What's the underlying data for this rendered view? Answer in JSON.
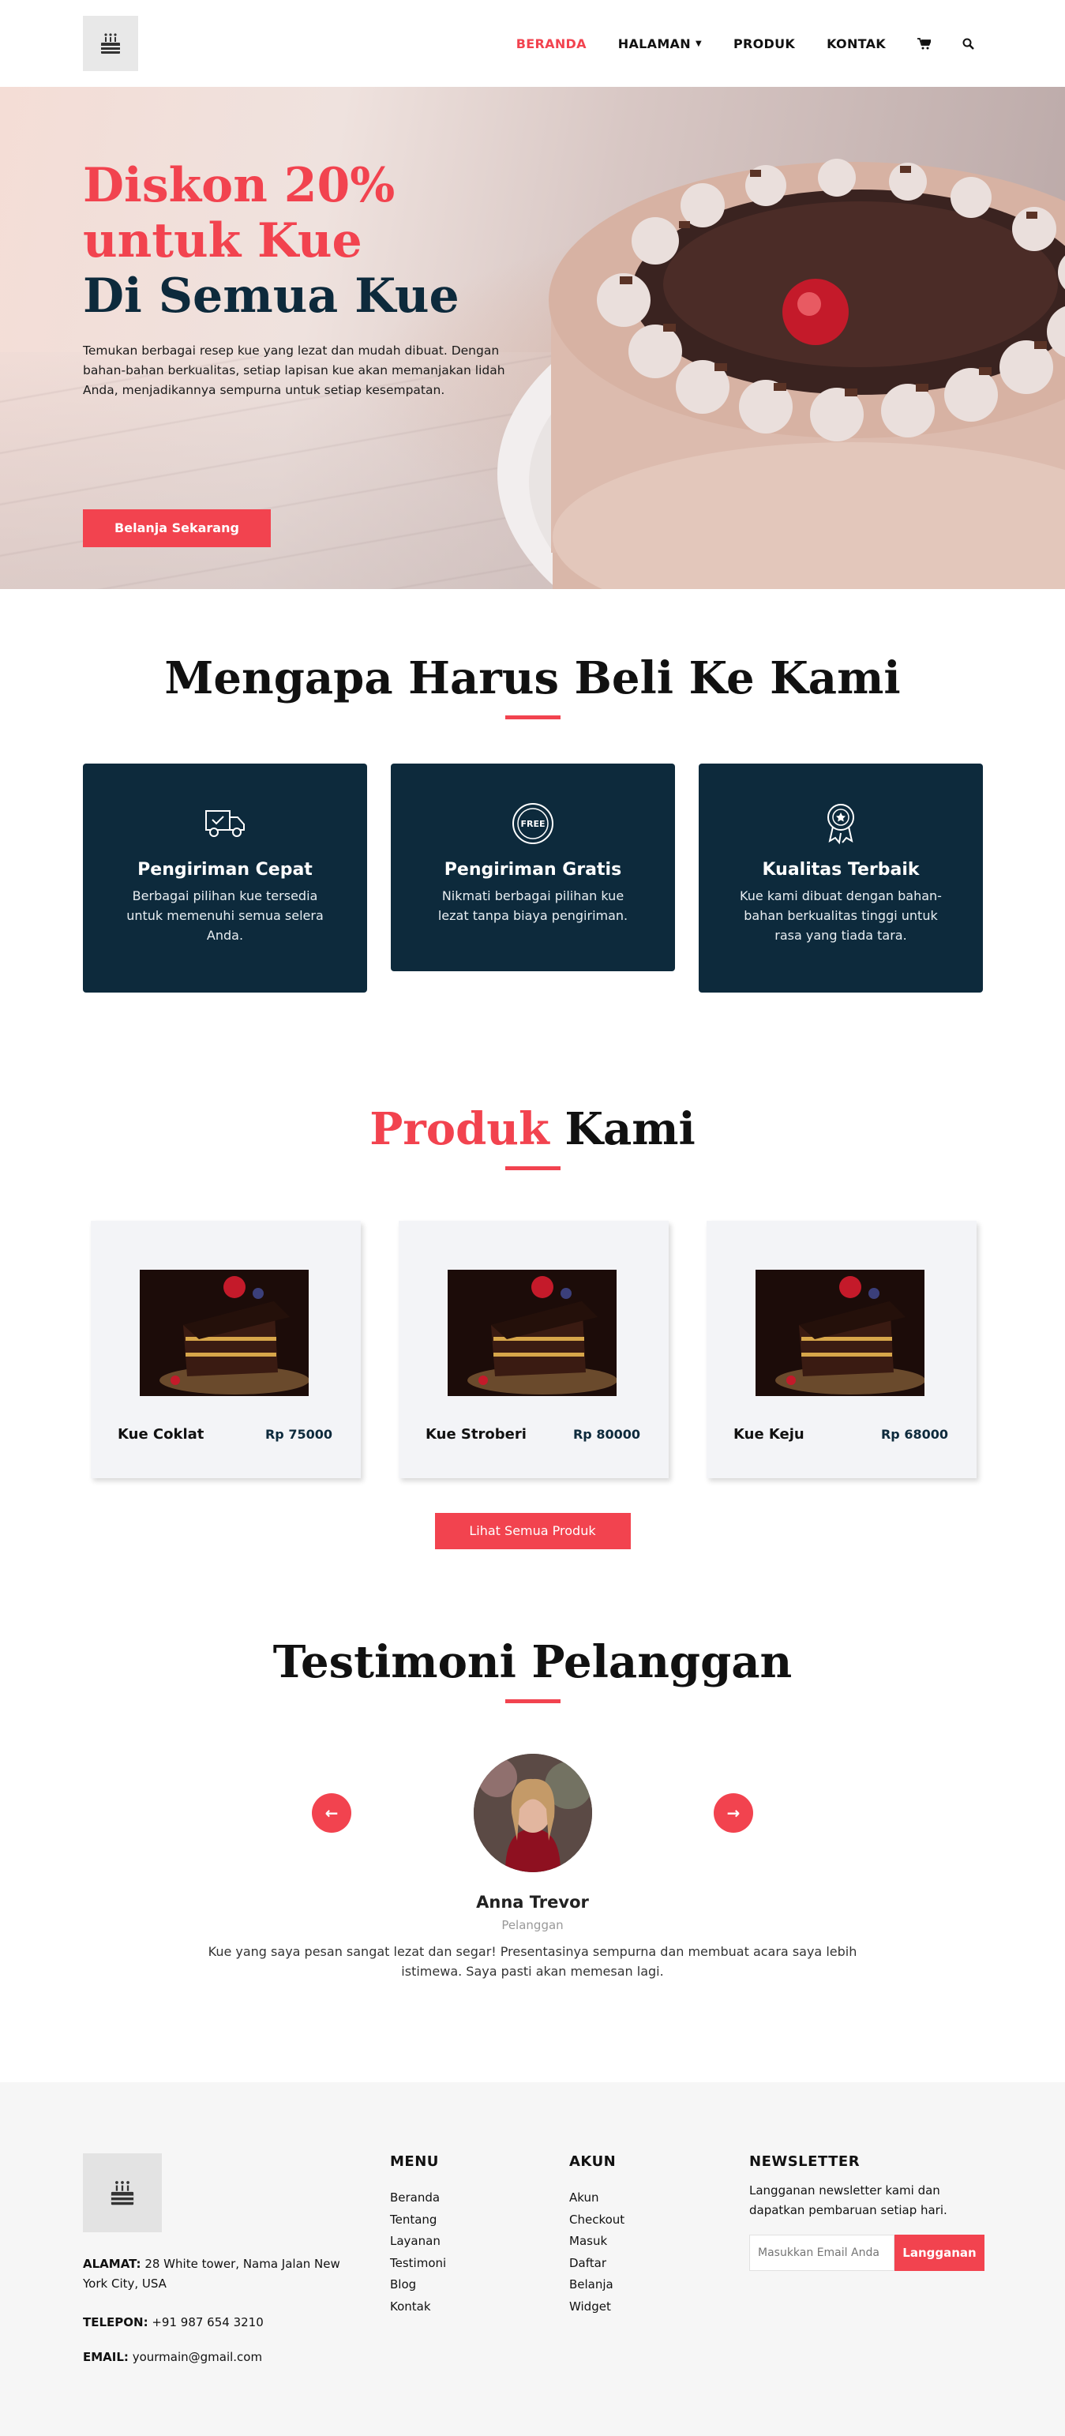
{
  "header": {
    "nav": [
      {
        "label": "BERANDA",
        "active": true
      },
      {
        "label": "HALAMAN",
        "dropdown": true
      },
      {
        "label": "PRODUK"
      },
      {
        "label": "KONTAK"
      }
    ],
    "icons": [
      "cake-logo-icon",
      "cart-icon",
      "search-icon"
    ]
  },
  "hero": {
    "title_line1": "Diskon 20%",
    "title_line2": "untuk Kue",
    "title_line3": "Di Semua Kue",
    "description": "Temukan berbagai resep kue yang lezat dan mudah dibuat. Dengan bahan-bahan berkualitas, setiap lapisan kue akan memanjakan lidah Anda, menjadikannya sempurna untuk setiap kesempatan.",
    "button": "Belanja Sekarang",
    "slides": 3,
    "active_slide": 1
  },
  "why": {
    "title": "Mengapa Harus Beli Ke Kami",
    "features": [
      {
        "icon": "delivery-truck-icon",
        "title": "Pengiriman Cepat",
        "desc": "Berbagai pilihan kue tersedia untuk memenuhi semua selera Anda."
      },
      {
        "icon": "free-badge-icon",
        "title": "Pengiriman Gratis",
        "desc": "Nikmati berbagai pilihan kue lezat tanpa biaya pengiriman."
      },
      {
        "icon": "quality-award-icon",
        "title": "Kualitas Terbaik",
        "desc": "Kue kami dibuat dengan bahan-bahan berkualitas tinggi untuk rasa yang tiada tara."
      }
    ]
  },
  "products": {
    "title_red": "Produk",
    "title_dark": " Kami",
    "items": [
      {
        "name": "Kue Coklat",
        "price": "Rp 75000"
      },
      {
        "name": "Kue Stroberi",
        "price": "Rp 80000"
      },
      {
        "name": "Kue Keju",
        "price": "Rp 68000"
      }
    ],
    "button": "Lihat Semua Produk"
  },
  "testimonials": {
    "title": "Testimoni Pelanggan",
    "name": "Anna Trevor",
    "role": "Pelanggan",
    "quote": "Kue yang saya pesan sangat lezat dan segar! Presentasinya sempurna dan membuat acara saya lebih istimewa. Saya pasti akan memesan lagi.",
    "prev": "←",
    "next": "→"
  },
  "footer": {
    "address_label": "ALAMAT:",
    "address": " 28 White tower, Nama Jalan New York City, USA",
    "phone_label": "TELEPON:",
    "phone": " +91 987 654 3210",
    "email_label": "EMAIL:",
    "email": " yourmain@gmail.com",
    "menu_title": "MENU",
    "menu": [
      "Beranda",
      "Tentang",
      "Layanan",
      "Testimoni",
      "Blog",
      "Kontak"
    ],
    "account_title": "AKUN",
    "account": [
      "Akun",
      "Checkout",
      "Masuk",
      "Daftar",
      "Belanja",
      "Widget"
    ],
    "newsletter_title": "NEWSLETTER",
    "newsletter_text": "Langganan newsletter kami dan dapatkan pembaruan setiap hari.",
    "newsletter_placeholder": "Masukkan Email Anda",
    "newsletter_button": "Langganan"
  },
  "colors": {
    "accent": "#f2434f",
    "navy": "#0d2a3c",
    "footer_bg": "#f6f6f6"
  }
}
